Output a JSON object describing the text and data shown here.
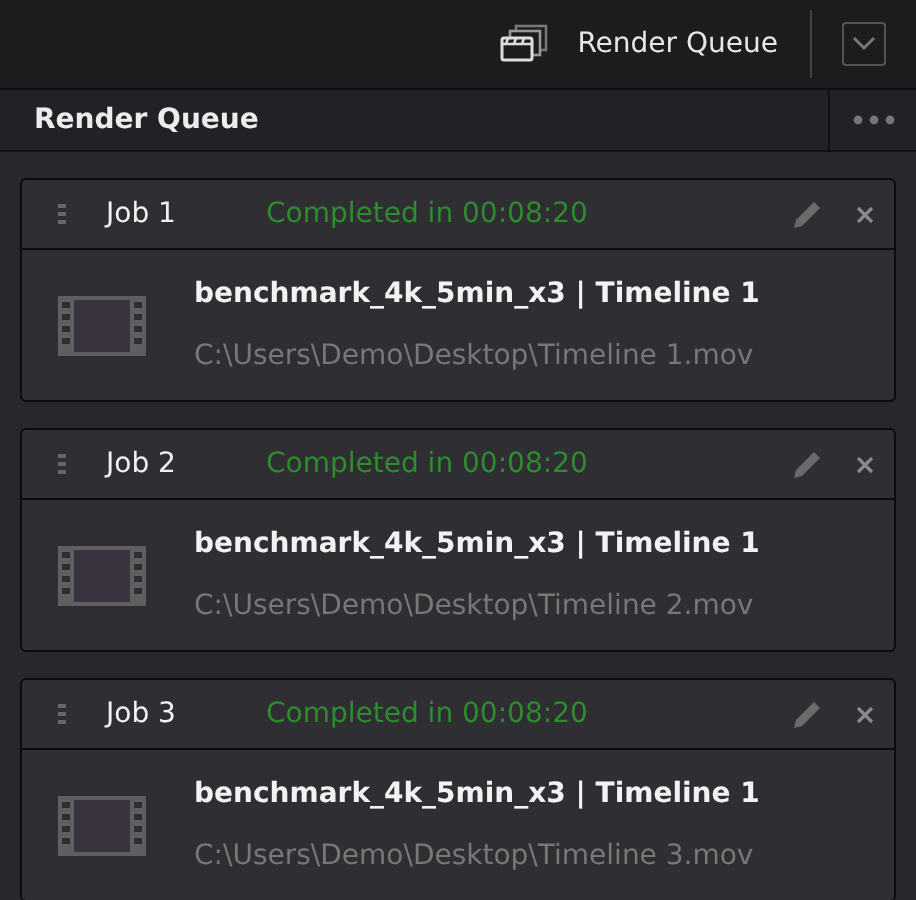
{
  "toolbar": {
    "button_label": "Render Queue"
  },
  "panel": {
    "title": "Render Queue"
  },
  "jobs": [
    {
      "name": "Job 1",
      "completed": true,
      "status_text": "Completed in 00:08:20",
      "title": "benchmark_4k_5min_x3 | Timeline 1",
      "path": "C:\\Users\\Demo\\Desktop\\Timeline 1.mov"
    },
    {
      "name": "Job 2",
      "completed": true,
      "status_text": "Completed in 00:08:20",
      "title": "benchmark_4k_5min_x3 | Timeline 1",
      "path": "C:\\Users\\Demo\\Desktop\\Timeline 2.mov"
    },
    {
      "name": "Job 3",
      "completed": true,
      "status_text": "Completed in 00:08:20",
      "title": "benchmark_4k_5min_x3 | Timeline 1",
      "path": "C:\\Users\\Demo\\Desktop\\Timeline 3.mov"
    }
  ]
}
